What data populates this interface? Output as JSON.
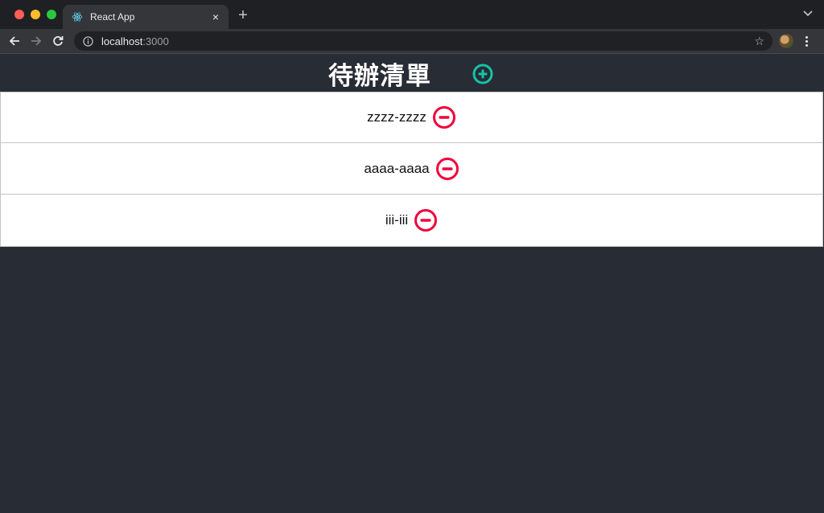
{
  "browser": {
    "tab": {
      "title": "React App",
      "close_glyph": "×",
      "favicon": "react-icon"
    },
    "new_tab_glyph": "+",
    "tab_menu_glyph": "⌄",
    "nav": {
      "back_glyph": "←",
      "forward_glyph": "→",
      "reload_glyph": "↻"
    },
    "url": {
      "host": "localhost",
      "port": ":3000"
    },
    "star_glyph": "☆",
    "colors": {
      "frame": "#1f2023",
      "toolbar": "#35363a",
      "omnibox": "#202124"
    }
  },
  "page": {
    "title": "待辦清單",
    "add_icon": "plus-circle-icon",
    "colors": {
      "background": "#282c34",
      "add": "#14c3a8",
      "remove": "#f0003c"
    },
    "todos": [
      {
        "text": "zzzz-zzzz",
        "remove_icon": "minus-circle-icon"
      },
      {
        "text": "aaaa-aaaa",
        "remove_icon": "minus-circle-icon"
      },
      {
        "text": "iii-iii",
        "remove_icon": "minus-circle-icon"
      }
    ]
  }
}
